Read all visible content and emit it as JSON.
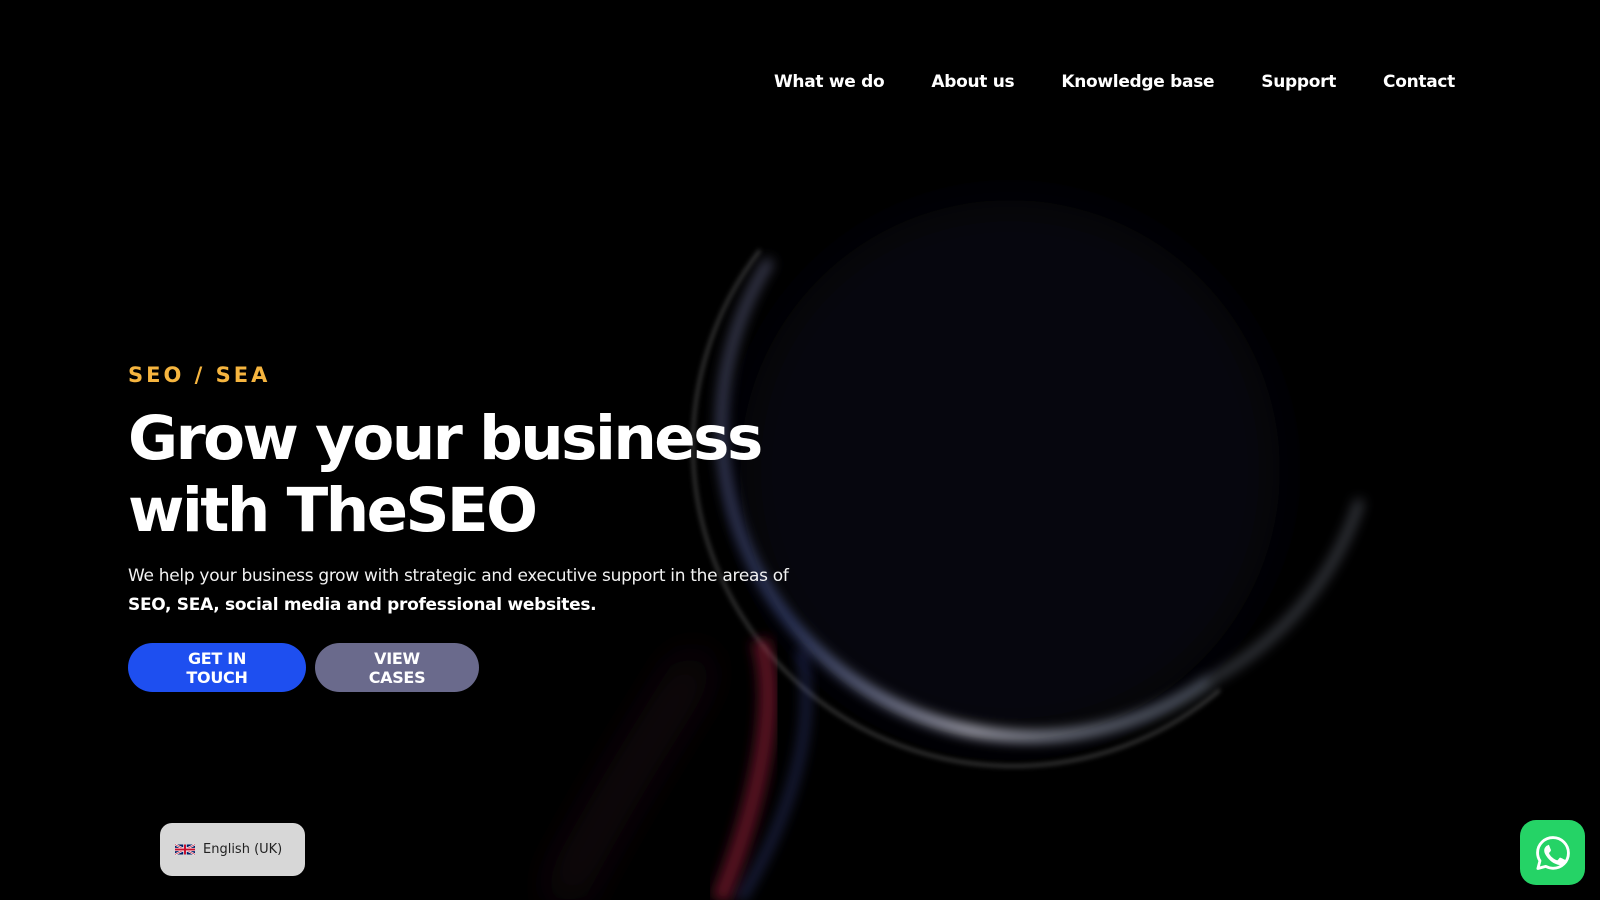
{
  "nav": {
    "items": [
      {
        "label": "What we do"
      },
      {
        "label": "About us"
      },
      {
        "label": "Knowledge base"
      },
      {
        "label": "Support"
      },
      {
        "label": "Contact"
      }
    ]
  },
  "hero": {
    "eyebrow": "SEO / SEA",
    "headline_line1": "Grow your business",
    "headline_line2": "with TheSEO",
    "subcopy_lead": "We help your business grow with strategic and executive support in the areas of ",
    "subcopy_bold": "SEO, SEA, social media and professional websites.",
    "cta_primary": "GET IN TOUCH",
    "cta_secondary": "VIEW CASES"
  },
  "language_selector": {
    "label": "English (UK)",
    "flag_icon": "uk-flag-icon"
  },
  "whatsapp": {
    "icon": "whatsapp-icon"
  },
  "colors": {
    "background": "#000000",
    "eyebrow": "#f6b53f",
    "primary_button": "#1e4ff0",
    "secondary_button": "#6a6a8c",
    "whatsapp": "#25d366"
  }
}
